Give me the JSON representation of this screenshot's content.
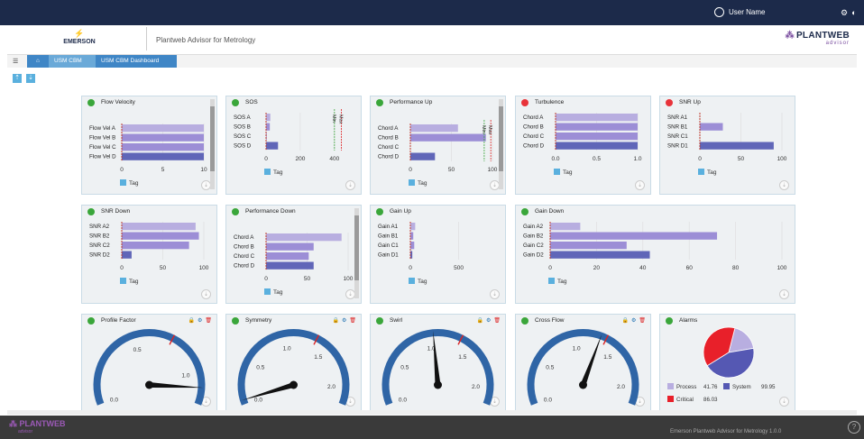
{
  "topbar": {
    "user_name": "User Name"
  },
  "header": {
    "brand": "EMERSON",
    "app_title": "Plantweb Advisor for Metrology",
    "logo_name": "PLANTWEB",
    "logo_sub": "advisor"
  },
  "breadcrumb": {
    "items": [
      "USM CBM",
      "USM CBM Dashboard"
    ]
  },
  "footer": {
    "logo": "PLANTWEB",
    "logo_sub": "advisor",
    "version_text": "Emerson Plantweb Advisor for Metrology 1.0.0",
    "help": "?"
  },
  "icons": {
    "menu": "hamburger-icon",
    "home": "home-icon",
    "user": "user-icon",
    "settings": "gears-icon",
    "upload": "upload-icon",
    "download": "download-icon",
    "lock": "lock-icon",
    "trash": "trash-icon",
    "help": "help-icon"
  },
  "colors": {
    "topbar": "#1c2a4a",
    "crumb_1": "#6aa9d8",
    "crumb_2": "#3f86c6",
    "status_ok": "#3aa63a",
    "status_alarm": "#e8333a",
    "bar_light": "#b8aee0",
    "bar_mid": "#9c8ed6",
    "bar_dark": "#6066b8",
    "gauge_arc": "#2f65a6",
    "tag": "#5ab0de"
  },
  "legend_tag": "Tag",
  "bar_panels": [
    {
      "title": "Flow Velocity",
      "status": "ok",
      "categories": [
        "Flow Vel A",
        "Flow Vel B",
        "Flow Vel C",
        "Flow Vel D"
      ],
      "values": [
        10,
        10,
        10,
        10
      ],
      "ticks": [
        "0",
        "5",
        "10"
      ],
      "xmax": 10
    },
    {
      "title": "SOS",
      "status": "ok",
      "categories": [
        "SOS A",
        "SOS B",
        "SOS C",
        "SOS D"
      ],
      "values": [
        25,
        22,
        4,
        70
      ],
      "ticks": [
        "0",
        "200",
        "400"
      ],
      "xmax": 480,
      "min_label": "Min",
      "max_label": "Max",
      "min_val": 400,
      "max_val": 440
    },
    {
      "title": "Performance Up",
      "status": "ok",
      "categories": [
        "Chord A",
        "Chord B",
        "Chord C",
        "Chord D"
      ],
      "values": [
        58,
        92,
        0,
        30
      ],
      "ticks": [
        "0",
        "50",
        "100"
      ],
      "xmax": 100,
      "min_label": "Min",
      "max_label": "Max",
      "min_val": 90,
      "max_val": 98
    },
    {
      "title": "Turbulence",
      "status": "alarm",
      "categories": [
        "Chord A",
        "Chord B",
        "Chord C",
        "Chord D"
      ],
      "values": [
        1,
        1,
        1,
        1
      ],
      "ticks": [
        "0.0",
        "0.5",
        "1.0"
      ],
      "xmax": 1
    },
    {
      "title": "SNR Up",
      "status": "alarm",
      "categories": [
        "SNR A1",
        "SNR B1",
        "SNR C1",
        "SNR D1"
      ],
      "values": [
        0,
        28,
        0,
        90
      ],
      "ticks": [
        "0",
        "50",
        "100"
      ],
      "xmax": 100
    },
    {
      "title": "SNR Down",
      "status": "ok",
      "categories": [
        "SNR A2",
        "SNR B2",
        "SNR C2",
        "SNR D2"
      ],
      "values": [
        90,
        94,
        82,
        12
      ],
      "ticks": [
        "0",
        "50",
        "100"
      ],
      "xmax": 100
    },
    {
      "title": "Performance Down",
      "status": "ok",
      "categories": [
        "Chord A",
        "Chord B",
        "Chord C",
        "Chord D"
      ],
      "values": [
        92,
        58,
        52,
        58
      ],
      "ticks": [
        "0",
        "50",
        "100"
      ],
      "xmax": 100
    },
    {
      "title": "Gain Up",
      "status": "ok",
      "categories": [
        "Gain A1",
        "Gain B1",
        "Gain C1",
        "Gain D1"
      ],
      "values": [
        50,
        30,
        40,
        20
      ],
      "ticks": [
        "0",
        "500"
      ],
      "xmax": 850
    },
    {
      "title": "Gain Down",
      "status": "ok",
      "categories": [
        "Gain A2",
        "Gain B2",
        "Gain C2",
        "Gain D2"
      ],
      "values": [
        13,
        72,
        33,
        43
      ],
      "ticks": [
        "0",
        "20",
        "40",
        "60",
        "80",
        "100"
      ],
      "xmax": 100
    }
  ],
  "gauge_panels": [
    {
      "title": "Profile Factor",
      "status": "ok",
      "value": 1.1,
      "min": 0,
      "max": 1.2,
      "ticks": [
        "0.0",
        "0.5",
        "1.0"
      ]
    },
    {
      "title": "Symmetry",
      "status": "ok",
      "value": 0.05,
      "min": 0,
      "max": 2.2,
      "ticks": [
        "0.0",
        "0.5",
        "1.0",
        "1.5",
        "2.0"
      ]
    },
    {
      "title": "Swirl",
      "status": "ok",
      "value": 1.05,
      "min": 0,
      "max": 2.2,
      "ticks": [
        "0.0",
        "0.5",
        "1.0",
        "1.5",
        "2.0"
      ]
    },
    {
      "title": "Cross Flow",
      "status": "ok",
      "value": 1.3,
      "min": 0,
      "max": 2.2,
      "ticks": [
        "0.0",
        "0.5",
        "1.0",
        "1.5",
        "2.0"
      ]
    }
  ],
  "alarms": {
    "title": "Alarms",
    "status": "ok",
    "slices": [
      {
        "label": "Process",
        "value": 41.76,
        "value_label": "41.76",
        "color": "#b8aee0"
      },
      {
        "label": "System",
        "value": 99.95,
        "value_label": "99.95",
        "color": "#5558b3"
      },
      {
        "label": "Critical",
        "value": 86.03,
        "value_label": "86.03",
        "color": "#e8202a"
      }
    ]
  },
  "chart_data": [
    {
      "type": "bar",
      "title": "Flow Velocity",
      "categories": [
        "Flow Vel A",
        "Flow Vel B",
        "Flow Vel C",
        "Flow Vel D"
      ],
      "series": [
        {
          "name": "Tag",
          "values": [
            10,
            10,
            10,
            10
          ]
        }
      ],
      "xlim": [
        0,
        10
      ]
    },
    {
      "type": "bar",
      "title": "SOS",
      "categories": [
        "SOS A",
        "SOS B",
        "SOS C",
        "SOS D"
      ],
      "series": [
        {
          "name": "Tag",
          "values": [
            25,
            22,
            4,
            70
          ]
        }
      ],
      "xlim": [
        0,
        480
      ]
    },
    {
      "type": "bar",
      "title": "Performance Up",
      "categories": [
        "Chord A",
        "Chord B",
        "Chord C",
        "Chord D"
      ],
      "series": [
        {
          "name": "Tag",
          "values": [
            58,
            92,
            0,
            30
          ]
        }
      ],
      "xlim": [
        0,
        100
      ]
    },
    {
      "type": "bar",
      "title": "Turbulence",
      "categories": [
        "Chord A",
        "Chord B",
        "Chord C",
        "Chord D"
      ],
      "series": [
        {
          "name": "Tag",
          "values": [
            1,
            1,
            1,
            1
          ]
        }
      ],
      "xlim": [
        0,
        1
      ]
    },
    {
      "type": "bar",
      "title": "SNR Up",
      "categories": [
        "SNR A1",
        "SNR B1",
        "SNR C1",
        "SNR D1"
      ],
      "series": [
        {
          "name": "Tag",
          "values": [
            0,
            28,
            0,
            90
          ]
        }
      ],
      "xlim": [
        0,
        100
      ]
    },
    {
      "type": "bar",
      "title": "SNR Down",
      "categories": [
        "SNR A2",
        "SNR B2",
        "SNR C2",
        "SNR D2"
      ],
      "series": [
        {
          "name": "Tag",
          "values": [
            90,
            94,
            82,
            12
          ]
        }
      ],
      "xlim": [
        0,
        100
      ]
    },
    {
      "type": "bar",
      "title": "Performance Down",
      "categories": [
        "Chord A",
        "Chord B",
        "Chord C",
        "Chord D"
      ],
      "series": [
        {
          "name": "Tag",
          "values": [
            92,
            58,
            52,
            58
          ]
        }
      ],
      "xlim": [
        0,
        100
      ]
    },
    {
      "type": "bar",
      "title": "Gain Up",
      "categories": [
        "Gain A1",
        "Gain B1",
        "Gain C1",
        "Gain D1"
      ],
      "series": [
        {
          "name": "Tag",
          "values": [
            50,
            30,
            40,
            20
          ]
        }
      ],
      "xlim": [
        0,
        850
      ]
    },
    {
      "type": "bar",
      "title": "Gain Down",
      "categories": [
        "Gain A2",
        "Gain B2",
        "Gain C2",
        "Gain D2"
      ],
      "series": [
        {
          "name": "Tag",
          "values": [
            13,
            72,
            33,
            43
          ]
        }
      ],
      "xlim": [
        0,
        100
      ]
    },
    {
      "type": "pie",
      "title": "Alarms",
      "categories": [
        "Process",
        "System",
        "Critical"
      ],
      "values": [
        41.76,
        99.95,
        86.03
      ]
    }
  ]
}
